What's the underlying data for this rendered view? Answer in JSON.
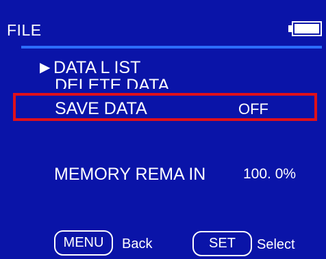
{
  "header": {
    "title": "FILE",
    "battery_icon": "battery-icon",
    "battery_level": 1.0,
    "accent_color": "#2c6dff"
  },
  "menu": {
    "pointer": "▶",
    "pointer_icon": "play-triangle-icon",
    "items": [
      {
        "label": "DATA L IST"
      },
      {
        "label": "DELETE DATA"
      },
      {
        "label": "SAVE DATA",
        "value": "OFF"
      }
    ],
    "highlight_color": "#e0101a"
  },
  "memory": {
    "label": "MEMORY REMA IN",
    "value": "100. 0%"
  },
  "footer": {
    "menu_key": "MENU",
    "menu_hint": "Back",
    "set_key": "SET",
    "set_hint": "Select"
  },
  "colors": {
    "background": "#0a14a8",
    "text": "#ffffff"
  }
}
